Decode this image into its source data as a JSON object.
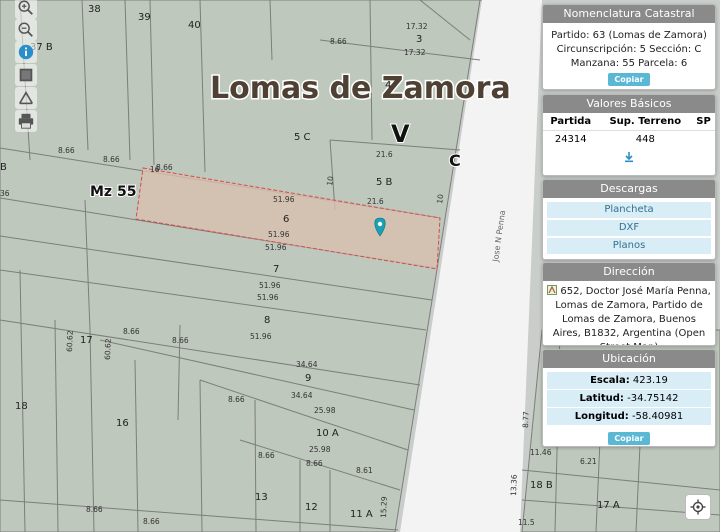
{
  "map": {
    "city_label": "Lomas de Zamora",
    "section_v": "V",
    "section_c": "C",
    "street": "Jose N Penna",
    "manzana_label": "Mz 55",
    "lot_labels": [
      "38",
      "39",
      "40",
      "37 B",
      "3",
      "4",
      "5 C",
      "5 B",
      "6",
      "7",
      "8",
      "9",
      "10 A",
      "11 A",
      "12",
      "13",
      "16",
      "17",
      "18",
      "17 A",
      "18 B",
      "B"
    ],
    "dims": [
      "51.96",
      "8.66",
      "10",
      "21.6",
      "17.32",
      "34.64",
      "25.98",
      "60.62",
      "8.61",
      "15.29",
      "8.77",
      "11.46",
      "6.21",
      "13.36",
      "11.5",
      "16",
      "36"
    ],
    "colors": {
      "background": "#c9ceca",
      "block": "#bfc8bd",
      "street": "#f3f3f3",
      "highlight_fill": "#d8bfae",
      "highlight_stroke": "#d44c4c",
      "marker": "#1aa1b4"
    }
  },
  "controls": [
    "zoom-in-icon",
    "zoom-out-icon",
    "info-icon",
    "layers-icon",
    "measure-icon",
    "print-icon"
  ],
  "panels": {
    "nomenclatura": {
      "title": "Nomenclatura Catastral",
      "line1": "Partido: 63 (Lomas de Zamora)",
      "line2": "Circunscripción: 5 Sección: C",
      "line3": "Manzana: 55 Parcela: 6",
      "copy_label": "Copiar"
    },
    "valores": {
      "title": "Valores Básicos",
      "headers": [
        "Partida",
        "Sup. Terreno",
        "SP"
      ],
      "row": [
        "24314",
        "448",
        ""
      ]
    },
    "descargas": {
      "title": "Descargas",
      "items": [
        "Plancheta",
        "DXF",
        "Planos"
      ]
    },
    "direccion": {
      "title": "Dirección",
      "text": "652, Doctor José María Penna, Lomas de Zamora, Partido de Lomas de Zamora, Buenos Aires, B1832, Argentina (Open Street Map)"
    },
    "ubicacion": {
      "title": "Ubicación",
      "escala_label": "Escala:",
      "escala_value": "423.19",
      "latitud_label": "Latitud:",
      "latitud_value": "-34.75142",
      "longitud_label": "Longitud:",
      "longitud_value": "-58.40981",
      "copy_label": "Copiar"
    }
  }
}
